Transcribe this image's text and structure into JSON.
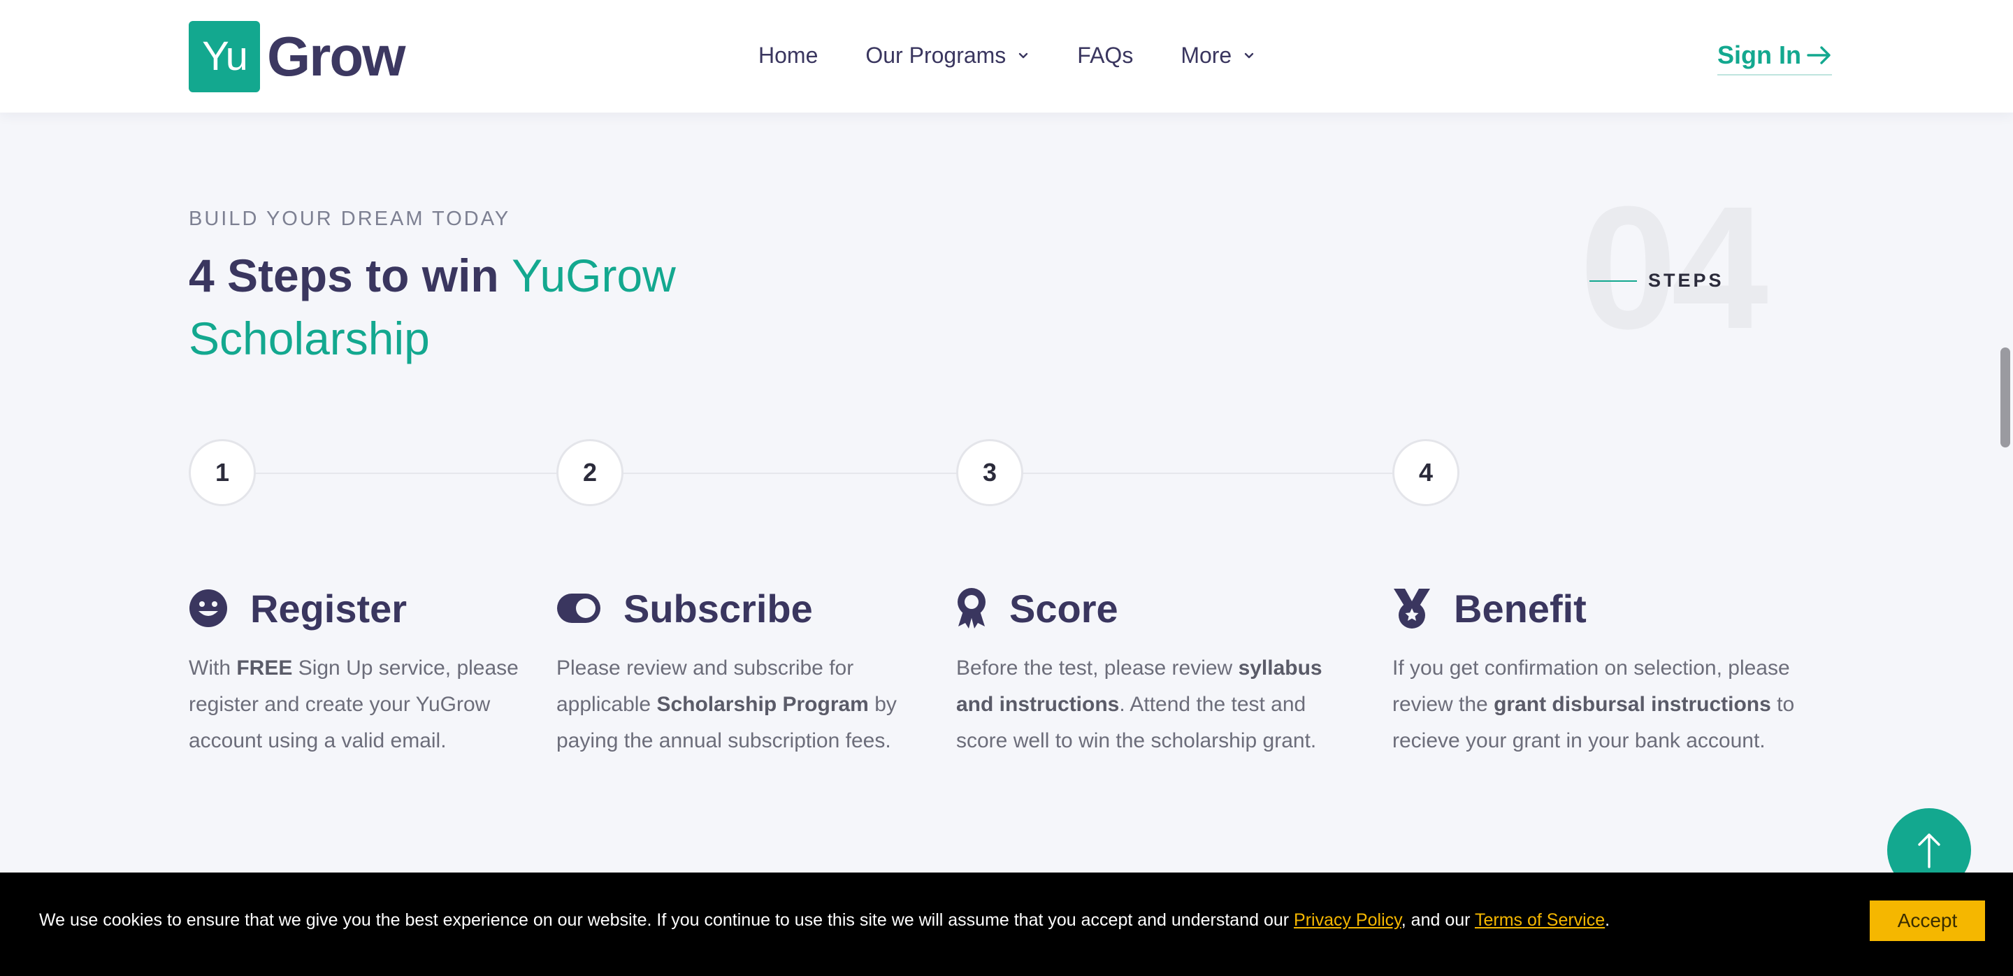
{
  "header": {
    "logo_box_text": "Yu",
    "logo_text": "Grow",
    "nav": [
      {
        "label": "Home",
        "has_dropdown": false
      },
      {
        "label": "Our Programs",
        "has_dropdown": true
      },
      {
        "label": "FAQs",
        "has_dropdown": false
      },
      {
        "label": "More",
        "has_dropdown": true
      }
    ],
    "signin_label": "Sign In"
  },
  "section": {
    "eyebrow": "BUILD YOUR DREAM TODAY",
    "title_plain": "4 Steps to win ",
    "title_accent": "YuGrow Scholarship",
    "big_number": "04",
    "steps_tag": "STEPS"
  },
  "timeline": [
    "1",
    "2",
    "3",
    "4"
  ],
  "steps": [
    {
      "icon": "smile-icon",
      "title": "Register",
      "desc_1": "With ",
      "desc_bold": "FREE",
      "desc_2": " Sign Up service, please register and create your YuGrow account using a valid email."
    },
    {
      "icon": "toggle-icon",
      "title": "Subscribe",
      "desc_1": "Please review and subscribe for applicable ",
      "desc_bold": "Scholarship Program",
      "desc_2": " by paying the annual subscription fees."
    },
    {
      "icon": "award-icon",
      "title": "Score",
      "desc_1": "Before the test, please review ",
      "desc_bold": "syllabus and instructions",
      "desc_2": ". Attend the test and score well to win the scholarship grant."
    },
    {
      "icon": "medal-icon",
      "title": "Benefit",
      "desc_1": "If you get confirmation on selection, please review the ",
      "desc_bold": "grant disbursal instructions",
      "desc_2": " to recieve your grant in your bank account."
    }
  ],
  "cookie": {
    "text_1": "We use cookies to ensure that we give you the best experience on our website. If you continue to use this site we will assume that you accept and understand our ",
    "privacy_link": "Privacy Policy",
    "text_2": ", and our ",
    "terms_link": "Terms of Service",
    "text_3": ".",
    "accept_label": "Accept"
  },
  "colors": {
    "accent": "#13a88f",
    "heading": "#3a365f",
    "cookie_link": "#f5b700",
    "background": "#f5f6fa"
  }
}
